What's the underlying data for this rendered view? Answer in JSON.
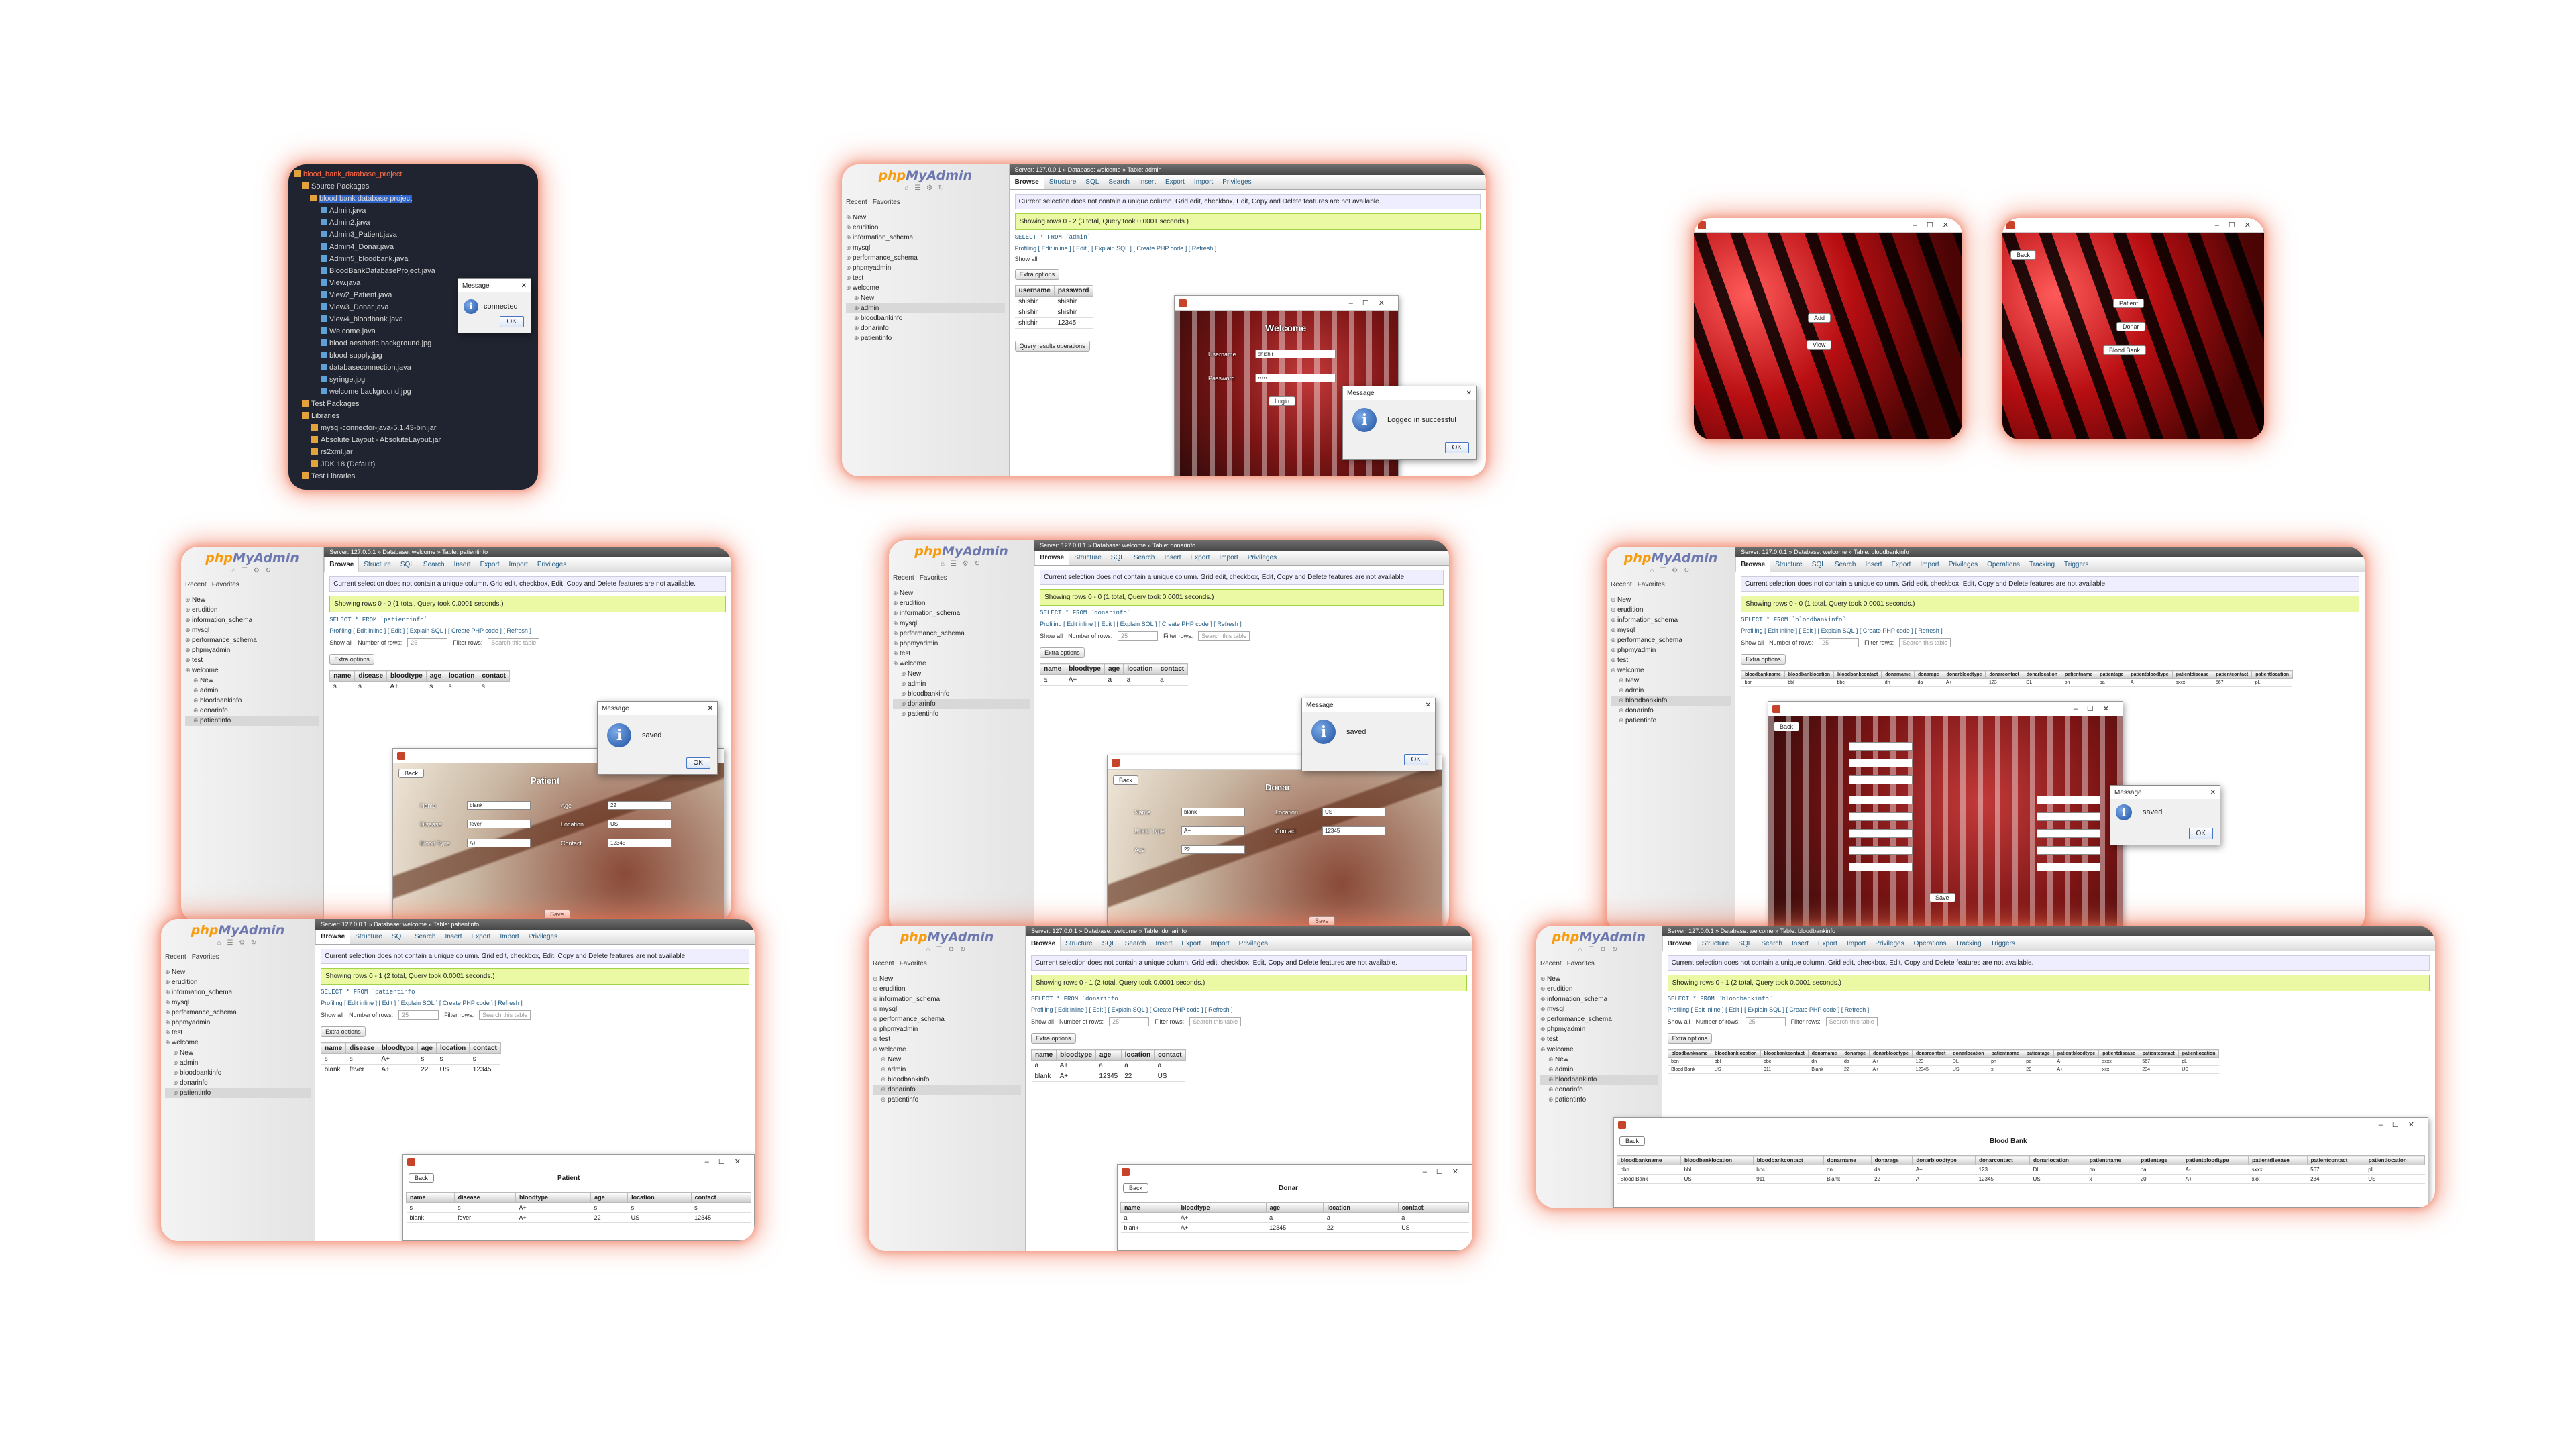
{
  "netbeans": {
    "project": "blood_bank_database_project",
    "source_packages": "Source Packages",
    "package": "blood bank database project",
    "files": [
      "Admin.java",
      "Admin2.java",
      "Admin3_Patient.java",
      "Admin4_Donar.java",
      "Admin5_bloodbank.java",
      "BloodBankDatabaseProject.java",
      "View.java",
      "View2_Patient.java",
      "View3_Donar.java",
      "View4_bloodbank.java",
      "Welcome.java",
      "blood aesthetic background.jpg",
      "blood supply.jpg",
      "databaseconnection.java",
      "syringe.jpg",
      "welcome background.jpg"
    ],
    "test_packages": "Test Packages",
    "libraries": "Libraries",
    "libs": [
      "mysql-connector-java-5.1.43-bin.jar",
      "Absolute Layout - AbsoluteLayout.jar",
      "rs2xml.jar",
      "JDK 18 (Default)"
    ],
    "test_libraries": "Test Libraries",
    "message": {
      "title": "Message",
      "text": "connected",
      "ok": "OK"
    }
  },
  "pma": {
    "logo_php": "php",
    "logo_myadmin": "MyAdmin",
    "recent": "Recent",
    "favorites": "Favorites",
    "tabs": [
      "Browse",
      "Structure",
      "SQL",
      "Search",
      "Insert",
      "Export",
      "Import",
      "Privileges"
    ],
    "tabs_wide": [
      "Browse",
      "Structure",
      "SQL",
      "Search",
      "Insert",
      "Export",
      "Import",
      "Privileges",
      "Operations",
      "Tracking",
      "Triggers"
    ],
    "notice": "Current selection does not contain a unique column. Grid edit, checkbox, Edit, Copy and Delete features are not available.",
    "profiling": "Profiling",
    "links": "[ Edit inline ] [ Edit ] [ Explain SQL ] [ Create PHP code ] [ Refresh ]",
    "show_all": "Show all",
    "number_of_rows": "Number of rows:",
    "rows_value": "25",
    "filter_rows": "Filter rows:",
    "filter_placeholder": "Search this table",
    "extra_options": "Extra options",
    "query_results": "Query results operations",
    "message_title": "Message",
    "ok": "OK",
    "back": "Back",
    "tree": [
      "New",
      "erudition",
      "information_schema",
      "mysql",
      "performance_schema",
      "phpmyadmin",
      "test",
      "welcome"
    ],
    "tree_welcome": [
      "New",
      "admin",
      "bloodbankinfo",
      "donarinfo",
      "patientinfo"
    ]
  },
  "admin_shot": {
    "crumb": "Server: 127.0.0.1 » Database: welcome » Table: admin",
    "success": "Showing rows 0 - 2 (3 total, Query took 0.0001 seconds.)",
    "sql": "SELECT * FROM `admin`",
    "columns": [
      "username",
      "password"
    ],
    "rows": [
      [
        "shishir",
        "shishir"
      ],
      [
        "shishir",
        "shishir"
      ],
      [
        "shishir",
        "12345"
      ]
    ],
    "welcome_title": "Welcome",
    "username_label": "Username",
    "username_value": "shishir",
    "password_label": "Password",
    "password_value": "•••••",
    "login": "Login",
    "message": "Logged in successful"
  },
  "menu1": {
    "add": "Add",
    "view": "View"
  },
  "menu2": {
    "back": "Back",
    "patient": "Patient",
    "donar": "Donar",
    "bloodbank": "Blood Bank"
  },
  "patient_insert": {
    "crumb": "Server: 127.0.0.1 » Database: welcome » Table: patientinfo",
    "success": "Showing rows 0 - 0 (1 total, Query took 0.0001 seconds.)",
    "sql": "SELECT * FROM `patientinfo`",
    "columns": [
      "name",
      "disease",
      "bloodtype",
      "age",
      "location",
      "contact"
    ],
    "rows": [
      [
        "s",
        "s",
        "A+",
        "s",
        "s",
        "s"
      ]
    ],
    "form_title": "Patient",
    "labels": [
      "Name",
      "Disease",
      "Blood Type",
      "Age",
      "Location",
      "Contact"
    ],
    "values": [
      "blank",
      "fever",
      "A+",
      "22",
      "US",
      "12345"
    ],
    "save": "Save",
    "message": "saved"
  },
  "donar_insert": {
    "crumb": "Server: 127.0.0.1 » Database: welcome » Table: donarinfo",
    "success": "Showing rows 0 - 0 (1 total, Query took 0.0001 seconds.)",
    "sql": "SELECT * FROM `donarinfo`",
    "columns": [
      "name",
      "bloodtype",
      "age",
      "location",
      "contact"
    ],
    "rows": [
      [
        "a",
        "A+",
        "a",
        "a",
        "a"
      ]
    ],
    "form_title": "Donar",
    "labels": [
      "Name",
      "Blood Type",
      "Age",
      "Location",
      "Contact"
    ],
    "values": [
      "blank",
      "A+",
      "22",
      "US",
      "12345"
    ],
    "save": "Save",
    "message": "saved"
  },
  "bank_insert": {
    "crumb": "Server: 127.0.0.1 » Database: welcome » Table: bloodbankinfo",
    "success": "Showing rows 0 - 0 (1 total, Query took 0.0001 seconds.)",
    "sql": "SELECT * FROM `bloodbankinfo`",
    "columns": [
      "bloodbankname",
      "bloodbanklocation",
      "bloodbankcontact",
      "donarname",
      "donarage",
      "donarbloodtype",
      "donarcontact",
      "donarlocation",
      "patientname",
      "patientage",
      "patientbloodtype",
      "patientdisease",
      "patientcontact",
      "patientlocation"
    ],
    "rows": [
      [
        "bbn",
        "bbl",
        "bbc",
        "dn",
        "da",
        "A+",
        "123",
        "DL",
        "pn",
        "pa",
        "A-",
        "sxxx",
        "567",
        "pL"
      ]
    ],
    "message": "saved"
  },
  "patient_view": {
    "crumb": "Server: 127.0.0.1 » Database: welcome » Table: patientinfo",
    "success": "Showing rows 0 - 1 (2 total, Query took 0.0001 seconds.)",
    "sql": "SELECT * FROM `patientinfo`",
    "columns": [
      "name",
      "disease",
      "bloodtype",
      "age",
      "location",
      "contact"
    ],
    "rows": [
      [
        "s",
        "s",
        "A+",
        "s",
        "s",
        "s"
      ],
      [
        "blank",
        "fever",
        "A+",
        "22",
        "US",
        "12345"
      ]
    ],
    "view_title": "Patient"
  },
  "donar_view": {
    "crumb": "Server: 127.0.0.1 » Database: welcome » Table: donarinfo",
    "success": "Showing rows 0 - 1 (2 total, Query took 0.0001 seconds.)",
    "sql": "SELECT * FROM `donarinfo`",
    "columns": [
      "name",
      "bloodtype",
      "age",
      "location",
      "contact"
    ],
    "rows": [
      [
        "a",
        "A+",
        "a",
        "a",
        "a"
      ],
      [
        "blank",
        "A+",
        "12345",
        "22",
        "US"
      ]
    ],
    "view_title": "Donar"
  },
  "bank_view": {
    "crumb": "Server: 127.0.0.1 » Database: welcome » Table: bloodbankinfo",
    "success": "Showing rows 0 - 1 (2 total, Query took 0.0001 seconds.)",
    "sql": "SELECT * FROM `bloodbankinfo`",
    "columns": [
      "bloodbankname",
      "bloodbanklocation",
      "bloodbankcontact",
      "donarname",
      "donarage",
      "donarbloodtype",
      "donarcontact",
      "donarlocation",
      "patientname",
      "patientage",
      "patientbloodtype",
      "patientdisease",
      "patientcontact",
      "patientlocation"
    ],
    "rows": [
      [
        "bbn",
        "bbl",
        "bbc",
        "dn",
        "da",
        "A+",
        "123",
        "DL",
        "pn",
        "pa",
        "A-",
        "sxxx",
        "567",
        "pL"
      ],
      [
        "Blood Bank",
        "US",
        "911",
        "Blank",
        "22",
        "A+",
        "12345",
        "US",
        "x",
        "20",
        "A+",
        "xxx",
        "234",
        "US"
      ]
    ],
    "view_title": "Blood Bank"
  }
}
